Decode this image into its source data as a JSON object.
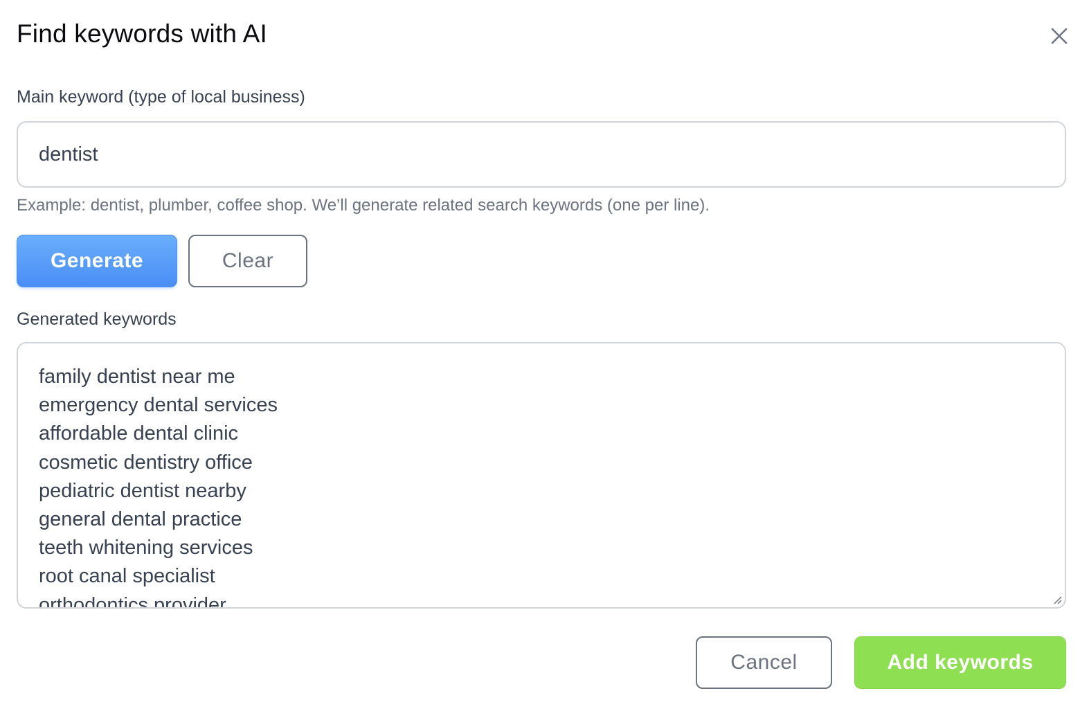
{
  "dialog": {
    "title": "Find keywords with AI"
  },
  "main_keyword": {
    "label": "Main keyword (type of local business)",
    "value": "dentist",
    "hint": "Example: dentist, plumber, coffee shop. We’ll generate related search keywords (one per line)."
  },
  "actions": {
    "generate_label": "Generate",
    "clear_label": "Clear"
  },
  "generated": {
    "label": "Generated keywords",
    "keywords": [
      "family dentist near me",
      "emergency dental services",
      "affordable dental clinic",
      "cosmetic dentistry office",
      "pediatric dentist nearby",
      "general dental practice",
      "teeth whitening services",
      "root canal specialist",
      "orthodontics provider"
    ]
  },
  "footer": {
    "cancel_label": "Cancel",
    "add_label": "Add keywords"
  },
  "colors": {
    "primary": "#4a8ef6",
    "success": "#8fdf52",
    "border": "#d1d5db",
    "muted_text": "#6b7280"
  }
}
